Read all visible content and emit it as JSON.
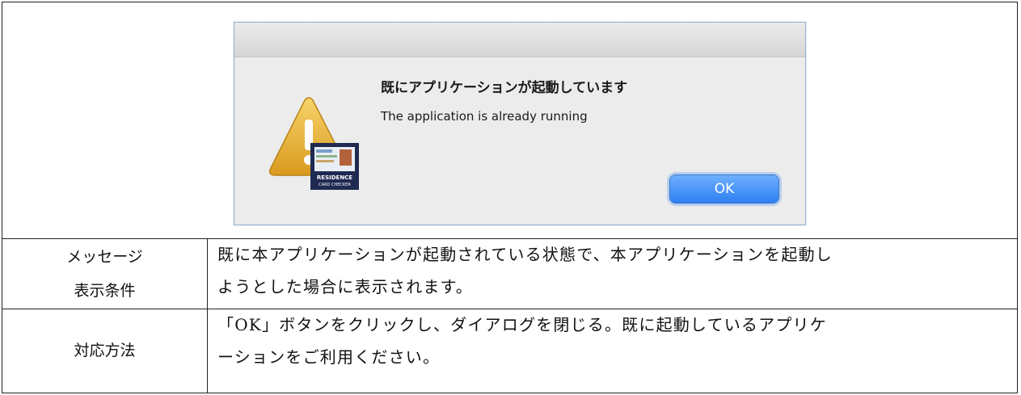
{
  "dialog": {
    "title": "既にアプリケーションが起動しています",
    "message": "The application is already running",
    "ok_label": "OK",
    "icon": "warning-icon",
    "badge_text_1": "RESIDENCE",
    "badge_text_2": "CARD CHECKER"
  },
  "table": {
    "condition_label_line1": "メッセージ",
    "condition_label_line2": "表示条件",
    "condition_text_line1": "既に本アプリケーションが起動されている状態で、本アプリケーションを起動し",
    "condition_text_line2": "ようとした場合に表示されます。",
    "action_label": "対応方法",
    "action_text_line1": "「OK」ボタンをクリックし、ダイアログを閉じる。既に起動しているアプリケ",
    "action_text_line2": "ーションをご利用ください。"
  }
}
